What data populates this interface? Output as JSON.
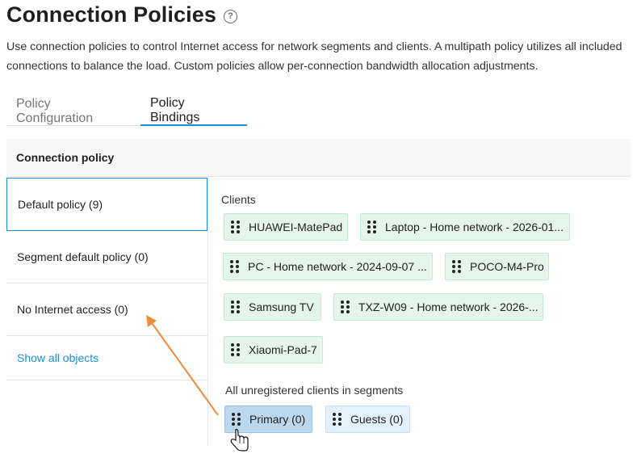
{
  "page": {
    "title": "Connection Policies",
    "help_icon": "question-circle-icon",
    "description": "Use connection policies to control Internet access for network segments and clients. A multipath policy utilizes all included connections to balance the load. Custom policies allow per-connection bandwidth allocation adjustments."
  },
  "tabs": [
    {
      "label": "Policy Configuration",
      "active": false
    },
    {
      "label": "Policy Bindings",
      "active": true
    }
  ],
  "panel": {
    "header": "Connection policy",
    "policies": [
      {
        "label": "Default policy (9)",
        "selected": true
      },
      {
        "label": "Segment default policy (0)",
        "selected": false
      },
      {
        "label": "No Internet access (0)",
        "selected": false
      }
    ],
    "show_all_link": "Show all objects"
  },
  "clients": {
    "label": "Clients",
    "items": [
      "HUAWEI-MatePad",
      "Laptop - Home network - 2026-01...",
      "PC - Home network - 2024-09-07 ...",
      "POCO-M4-Pro",
      "Samsung TV",
      "TXZ-W09 - Home network - 2026-...",
      "Xiaomi-Pad-7"
    ]
  },
  "segments": {
    "label": "All unregistered clients in segments",
    "items": [
      {
        "label": "Primary (0)",
        "active": true
      },
      {
        "label": "Guests (0)",
        "active": false
      }
    ]
  },
  "colors": {
    "accent": "#1a8fd8",
    "client_chip": "#e4f6ec",
    "segment_chip": "#e3f1fc",
    "segment_chip_active": "#bcd8ef",
    "annotation_arrow": "#f28a3c"
  }
}
